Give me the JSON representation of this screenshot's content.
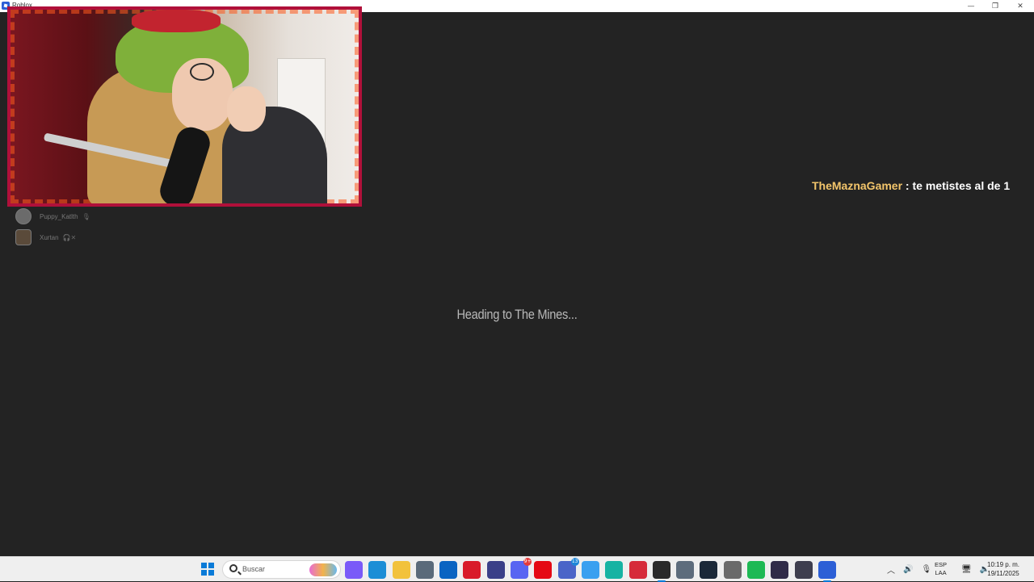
{
  "window": {
    "title": "Roblox",
    "minimize_glyph": "—",
    "maximize_glyph": "❐",
    "close_glyph": "✕"
  },
  "voice_users": [
    {
      "name": "Puppy_Katlth",
      "status_icon": "mic-icon"
    },
    {
      "name": "Xurtan",
      "status_icon": "deafened-icon"
    }
  ],
  "chat": {
    "username": "TheMaznaGamer",
    "separator": " : ",
    "message": "te metistes al de 1",
    "username_color": "#f3c56b"
  },
  "loading": {
    "text": "Heading to The Mines..."
  },
  "taskbar": {
    "search_placeholder": "Buscar",
    "apps": [
      {
        "name": "copilot-icon",
        "color": "#7a5af8",
        "selected": false
      },
      {
        "name": "edge-icon",
        "color": "#1c8ed6",
        "selected": false
      },
      {
        "name": "file-explorer-icon",
        "color": "#f2c23c",
        "selected": false
      },
      {
        "name": "store-icon",
        "color": "#5a6a7a",
        "selected": false
      },
      {
        "name": "outlook-icon",
        "color": "#0a64c2",
        "selected": false
      },
      {
        "name": "opera-icon",
        "color": "#d91b2a",
        "selected": false
      },
      {
        "name": "snipping-tool-icon",
        "color": "#3a3f88",
        "selected": false
      },
      {
        "name": "discord-icon",
        "color": "#5865f2",
        "selected": false,
        "badge": "9+"
      },
      {
        "name": "netflix-icon",
        "color": "#e50914",
        "selected": false
      },
      {
        "name": "teams-icon",
        "color": "#4a64c8",
        "selected": false,
        "badge": "13"
      },
      {
        "name": "windsurf-icon",
        "color": "#3aa0f0",
        "selected": false
      },
      {
        "name": "curseforge-icon",
        "color": "#16b3a3",
        "selected": false
      },
      {
        "name": "game-app-icon",
        "color": "#d62b3a",
        "selected": false
      },
      {
        "name": "epic-games-icon",
        "color": "#2a2a2a",
        "selected": true
      },
      {
        "name": "settings-icon",
        "color": "#5d6c7c",
        "selected": false
      },
      {
        "name": "steam-icon",
        "color": "#1b2838",
        "selected": false
      },
      {
        "name": "chrome-icon",
        "color": "#6a6a6a",
        "selected": false
      },
      {
        "name": "spotify-icon",
        "color": "#1db954",
        "selected": false
      },
      {
        "name": "obs-icon",
        "color": "#302b48",
        "selected": false
      },
      {
        "name": "twitch-app-icon",
        "color": "#3e3e4e",
        "selected": false
      },
      {
        "name": "roblox-icon",
        "color": "#2c5fd6",
        "selected": true
      }
    ],
    "tray": {
      "lang_top": "ESP",
      "lang_bottom": "LAA",
      "time": "10:19 p. m.",
      "date": "19/11/2025"
    }
  }
}
